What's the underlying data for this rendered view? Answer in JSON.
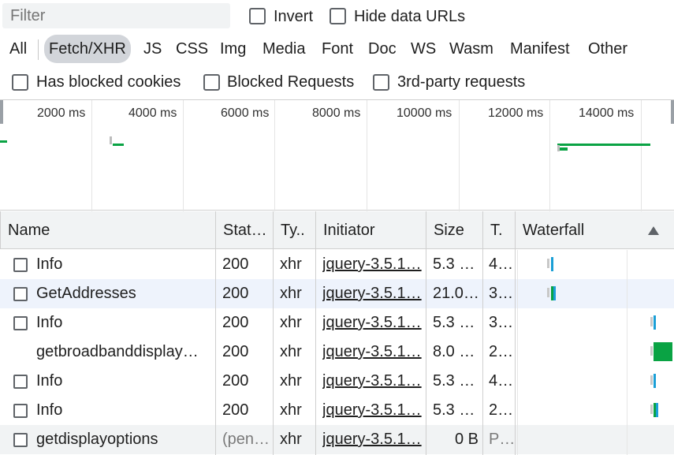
{
  "toolbar": {
    "filter_placeholder": "Filter",
    "invert_label": "Invert",
    "hide_data_urls_label": "Hide data URLs"
  },
  "type_filters": [
    {
      "label": "All",
      "active": false
    },
    {
      "label": "Fetch/XHR",
      "active": true
    },
    {
      "label": "JS",
      "active": false
    },
    {
      "label": "CSS",
      "active": false
    },
    {
      "label": "Img",
      "active": false
    },
    {
      "label": "Media",
      "active": false
    },
    {
      "label": "Font",
      "active": false
    },
    {
      "label": "Doc",
      "active": false
    },
    {
      "label": "WS",
      "active": false
    },
    {
      "label": "Wasm",
      "active": false
    },
    {
      "label": "Manifest",
      "active": false
    },
    {
      "label": "Other",
      "active": false
    }
  ],
  "checkboxes": {
    "blocked_cookies": "Has blocked cookies",
    "blocked_requests": "Blocked Requests",
    "third_party": "3rd-party requests"
  },
  "overview": {
    "ticks": [
      "2000 ms",
      "4000 ms",
      "6000 ms",
      "8000 ms",
      "10000 ms",
      "12000 ms",
      "14000 ms"
    ]
  },
  "columns": {
    "name": "Name",
    "status": "Stat…",
    "type": "Ty..",
    "initiator": "Initiator",
    "size": "Size",
    "time": "T.",
    "waterfall": "Waterfall"
  },
  "rows": [
    {
      "name": "Info",
      "status": "200",
      "type": "xhr",
      "initiator": "jquery-3.5.1…",
      "size": "5.3 …",
      "time": "4…"
    },
    {
      "name": "GetAddresses",
      "status": "200",
      "type": "xhr",
      "initiator": "jquery-3.5.1…",
      "size": "21.0…",
      "time": "3…"
    },
    {
      "name": "Info",
      "status": "200",
      "type": "xhr",
      "initiator": "jquery-3.5.1…",
      "size": "5.3 …",
      "time": "3…"
    },
    {
      "name": "getbroadbanddisplay…",
      "status": "200",
      "type": "xhr",
      "initiator": "jquery-3.5.1…",
      "size": "8.0 …",
      "time": "2…"
    },
    {
      "name": "Info",
      "status": "200",
      "type": "xhr",
      "initiator": "jquery-3.5.1…",
      "size": "5.3 …",
      "time": "4…"
    },
    {
      "name": "Info",
      "status": "200",
      "type": "xhr",
      "initiator": "jquery-3.5.1…",
      "size": "5.3 …",
      "time": "2…"
    },
    {
      "name": "getdisplayoptions",
      "status": "(pen…",
      "type": "xhr",
      "initiator": "jquery-3.5.1…",
      "size": "0 B",
      "time": "P…"
    }
  ],
  "colors": {
    "waiting": "#1a9fd6",
    "download": "#0aa344",
    "queue": "#bdbdbd"
  }
}
